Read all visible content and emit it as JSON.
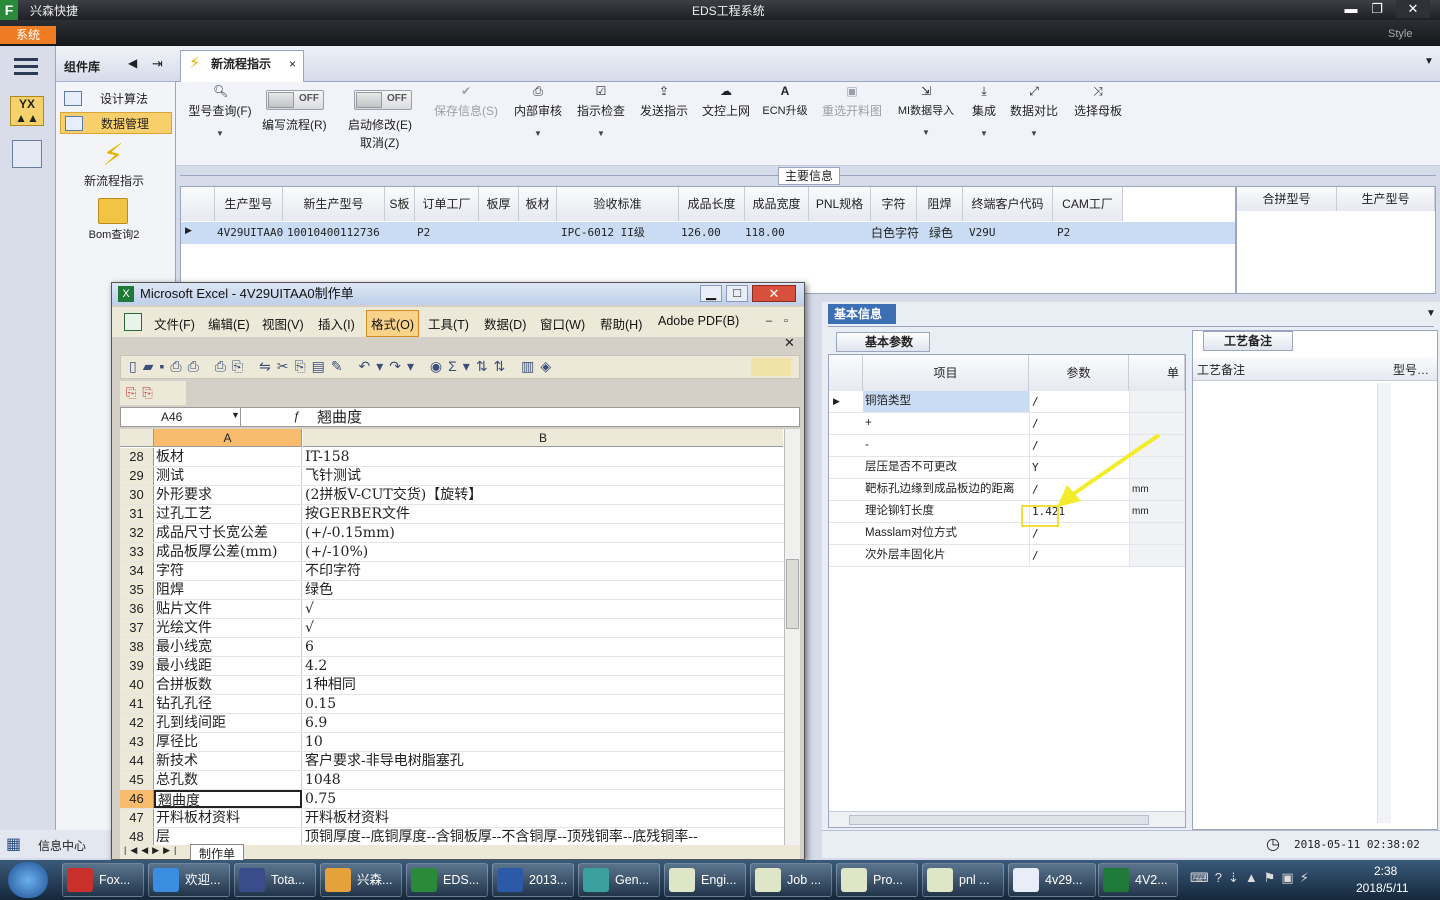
{
  "app": {
    "name": "兴森快捷",
    "window_title": "EDS工程系统",
    "system_button": "系统",
    "style_label": "Style"
  },
  "window_controls": {
    "minimize": "▬",
    "maximize": "❐",
    "close": "✕"
  },
  "component_panel": {
    "title": "组件库",
    "items": [
      {
        "label": "设计算法"
      },
      {
        "label": "数据管理"
      },
      {
        "label": "新流程指示"
      },
      {
        "label": "Bom查询2"
      }
    ]
  },
  "tab": {
    "label": "新流程指示",
    "close": "×"
  },
  "toolbar": {
    "items": [
      {
        "label": "型号查询(F)"
      },
      {
        "label": "编写流程(R)",
        "toggle": "OFF"
      },
      {
        "label": "启动修改(E)",
        "label2": "取消(Z)",
        "toggle": "OFF"
      },
      {
        "label": "保存信息(S)"
      },
      {
        "label": "内部审核"
      },
      {
        "label": "指示检查"
      },
      {
        "label": "发送指示"
      },
      {
        "label": "文控上网"
      },
      {
        "label": "ECN升级"
      },
      {
        "label": "重选开料图"
      },
      {
        "label": "MI数据导入"
      },
      {
        "label": "集成"
      },
      {
        "label": "数据对比"
      },
      {
        "label": "选择母板"
      }
    ]
  },
  "main_info": {
    "title": "主要信息",
    "columns": [
      "生产型号",
      "新生产型号",
      "S板",
      "订单工厂",
      "板厚",
      "板材",
      "验收标准",
      "成品长度",
      "成品宽度",
      "PNL规格",
      "字符",
      "阻焊",
      "终端客户代码",
      "CAM工厂"
    ],
    "row": [
      "4V29UITAA0",
      "10010400112736",
      "",
      "P2",
      "",
      "",
      "IPC-6012 II级",
      "126.00",
      "118.00",
      "",
      "白色字符",
      "绿色",
      "V29U",
      "P2"
    ],
    "merge_columns": [
      "合拼型号",
      "生产型号"
    ]
  },
  "basic_info": {
    "title": "基本信息",
    "param_tab": "基本参数",
    "note_tab": "工艺备注",
    "columns": [
      "项目",
      "参数",
      "单位"
    ],
    "rows": [
      {
        "item": "铜箔类型",
        "value": "/",
        "unit": ""
      },
      {
        "item": "+",
        "value": "/",
        "unit": ""
      },
      {
        "item": "-",
        "value": "/",
        "unit": ""
      },
      {
        "item": "层压是否不可更改",
        "value": "Y",
        "unit": ""
      },
      {
        "item": "靶标孔边缘到成品板边的距离",
        "value": "/",
        "unit": "mm"
      },
      {
        "item": "理论铆钉长度",
        "value": "1.421",
        "unit": "mm"
      },
      {
        "item": "Masslam对位方式",
        "value": "/",
        "unit": ""
      },
      {
        "item": "次外层丰固化片",
        "value": "/",
        "unit": ""
      }
    ],
    "note_columns": [
      "工艺备注",
      "型号…"
    ]
  },
  "status": {
    "info_center": "信息中心",
    "datetime": "2018-05-11 02:38:02"
  },
  "excel": {
    "title": "Microsoft Excel - 4V29UITAA0制作单",
    "menus": [
      "文件(F)",
      "编辑(E)",
      "视图(V)",
      "插入(I)",
      "格式(O)",
      "工具(T)",
      "数据(D)",
      "窗口(W)",
      "帮助(H)",
      "Adobe PDF(B)"
    ],
    "name_box": "A46",
    "formula": "翘曲度",
    "col_a": "A",
    "col_b": "B",
    "sheet_tab": "制作单",
    "rows": [
      {
        "n": "28",
        "a": "板材",
        "b": "IT-158"
      },
      {
        "n": "29",
        "a": "测试",
        "b": "飞针测试"
      },
      {
        "n": "30",
        "a": "外形要求",
        "b": "(2拼板V-CUT交货)【旋转】"
      },
      {
        "n": "31",
        "a": "过孔工艺",
        "b": "按GERBER文件"
      },
      {
        "n": "32",
        "a": "成品尺寸长宽公差",
        "b": "(+/-0.15mm)"
      },
      {
        "n": "33",
        "a": "成品板厚公差(mm)",
        "b": "(+/-10%)"
      },
      {
        "n": "34",
        "a": "字符",
        "b": "不印字符"
      },
      {
        "n": "35",
        "a": "阻焊",
        "b": "绿色"
      },
      {
        "n": "36",
        "a": "贴片文件",
        "b": "√"
      },
      {
        "n": "37",
        "a": "光绘文件",
        "b": "√"
      },
      {
        "n": "38",
        "a": "最小线宽",
        "b": "6"
      },
      {
        "n": "39",
        "a": "最小线距",
        "b": "4.2"
      },
      {
        "n": "40",
        "a": "合拼板数",
        "b": "1种相同"
      },
      {
        "n": "41",
        "a": "钻孔孔径",
        "b": "0.15"
      },
      {
        "n": "42",
        "a": "孔到线间距",
        "b": "6.9"
      },
      {
        "n": "43",
        "a": "厚径比",
        "b": "10"
      },
      {
        "n": "44",
        "a": "新技术",
        "b": "客户要求-非导电树脂塞孔"
      },
      {
        "n": "45",
        "a": "总孔数",
        "b": "1048"
      },
      {
        "n": "46",
        "a": "翘曲度",
        "b": "0.75"
      },
      {
        "n": "47",
        "a": "开料板材资料",
        "b": "开料板材资料"
      },
      {
        "n": "48",
        "a": "层",
        "b": "顶铜厚度--底铜厚度--含铜板厚--不含铜厚--顶残铜率--底残铜率--"
      }
    ]
  },
  "taskbar": {
    "items": [
      "Fox...",
      "欢迎...",
      "Tota...",
      "兴森...",
      "EDS...",
      "2013...",
      "Gen...",
      "Engi...",
      "Job ...",
      "Pro...",
      "pnl ...",
      "4v29...",
      "4V2..."
    ],
    "time": "2:38",
    "date": "2018/5/11"
  }
}
